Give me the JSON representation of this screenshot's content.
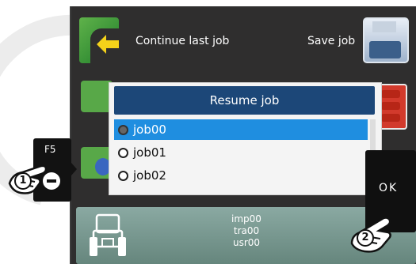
{
  "main_menu": {
    "continue_last_job": "Continue last job",
    "save_job": "Save job"
  },
  "dialog": {
    "title": "Resume job",
    "options": [
      {
        "label": "job00",
        "selected": true
      },
      {
        "label": "job01",
        "selected": false
      },
      {
        "label": "job02",
        "selected": false
      }
    ]
  },
  "job_info": {
    "implement": "imp00",
    "tractor": "tra00",
    "user": "usr00"
  },
  "keys": {
    "f5_label": "F5",
    "ok_label": "OK"
  },
  "steps": {
    "step1": "1",
    "step2": "2"
  },
  "icons": {
    "continue": "continue-arrow-icon",
    "save": "floppy-disk-icon",
    "tractor": "tractor-icon",
    "minus": "minus-icon",
    "hand": "pointing-hand-icon"
  },
  "colors": {
    "dialog_title": "#1c4778",
    "selection": "#1f8ee0",
    "screen_bg": "#2f2e2e"
  }
}
